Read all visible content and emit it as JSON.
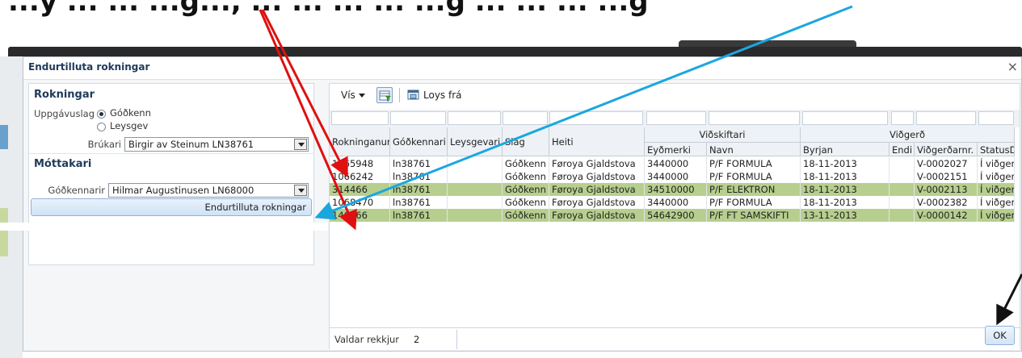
{
  "background": {
    "overflow_text": "...y ... ... ...g..., ... ... ... ... ...g ... ... ... ...g"
  },
  "dialog": {
    "title": "Endurtilluta rokningar",
    "close_glyph": "×",
    "left": {
      "section1": "Rokningar",
      "uppgavuslag_label": "Uppgávuslag",
      "radio_options": [
        "Góðkenn",
        "Leysgev"
      ],
      "selected_radio": "Góðkenn",
      "brukari_label": "Brúkari",
      "brukari_value": "Birgir av Steinum LN38761",
      "section2": "Móttakari",
      "godkennari_label": "Góðkennarir",
      "godkennari_value": "Hilmar Augustinusen LN68000",
      "submit_label": "Endurtilluta rokningar"
    },
    "toolbar": {
      "vis_label": "Vís",
      "loys_label": "Loys frá"
    },
    "table": {
      "group_headers": {
        "vidskiftari": "Viðskiftari",
        "vidgerd": "Viðgerð"
      },
      "columns": [
        "Rokninganur",
        "Góðkennari",
        "Leysgevari",
        "Slag",
        "Heiti",
        "Eyðmerki",
        "Navn",
        "Byrjan",
        "Endi",
        "Viðgerðarnr.",
        "StatusDisp"
      ],
      "rows": [
        [
          "1065948",
          "ln38761",
          "",
          "Góðkenn",
          "Føroya Gjaldstova",
          "3440000",
          "P/F FORMULA",
          "18-11-2013",
          "",
          "V-0002027",
          "Í viðgerð"
        ],
        [
          "1066242",
          "ln38761",
          "",
          "Góðkenn",
          "Føroya Gjaldstova",
          "3440000",
          "P/F FORMULA",
          "18-11-2013",
          "",
          "V-0002151",
          "Í viðgerð"
        ],
        [
          "314466",
          "ln38761",
          "",
          "Góðkenn",
          "Føroya Gjaldstova",
          "34510000",
          "P/F ELEKTRON",
          "18-11-2013",
          "",
          "V-0002113",
          "Í viðgerð"
        ],
        [
          "1068470",
          "ln38761",
          "",
          "Góðkenn",
          "Føroya Gjaldstova",
          "3440000",
          "P/F FORMULA",
          "18-11-2013",
          "",
          "V-0002382",
          "Í viðgerð"
        ],
        [
          "146266",
          "ln38761",
          "",
          "Góðkenn",
          "Føroya Gjaldstova",
          "54642900",
          "P/F FT SAMSKIFTI",
          "13-11-2013",
          "",
          "V-0000142",
          "Í viðgerð"
        ]
      ],
      "selected_rows": [
        2,
        4
      ]
    },
    "status": {
      "label": "Valdar rekkjur",
      "value": "2"
    },
    "ok_label": "OK"
  },
  "colors": {
    "selected_row": "#b7cf8e",
    "arrow_red": "#e01010",
    "arrow_blue": "#1aa7e0",
    "arrow_black": "#111111"
  }
}
